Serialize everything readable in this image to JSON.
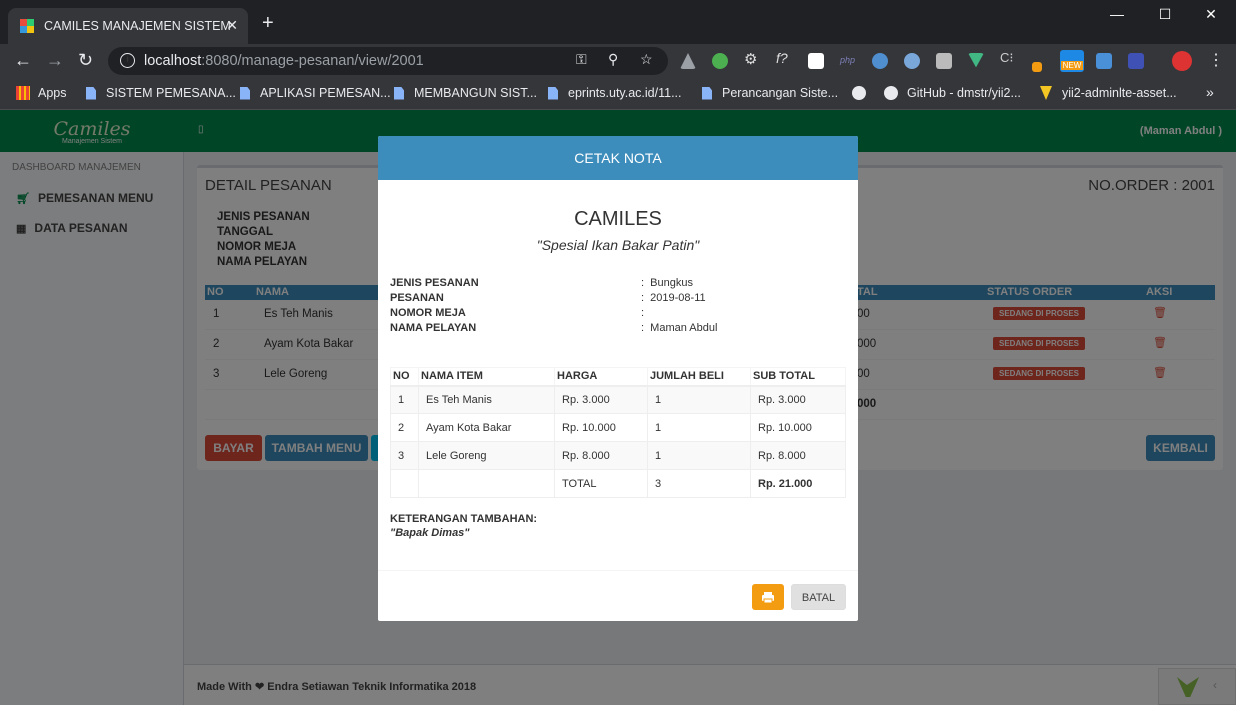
{
  "browser": {
    "tab_title": "CAMILES MANAJEMEN SISTEM",
    "url_host": "localhost",
    "url_path": ":8080/manage-pesanan/view/2001",
    "bookmarks": [
      "Apps",
      "SISTEM PEMESANA...",
      "APLIKASI PEMESAN...",
      "MEMBANGUN SIST...",
      "eprints.uty.ac.id/11...",
      "Perancangan Siste...",
      "GitHub - dmstr/yii2...",
      "yii2-adminlte-asset..."
    ],
    "new_badge": "NEW"
  },
  "app": {
    "logo": "Camiles",
    "logo_sub": "Manajemen Sistem",
    "user": "(Maman Abdul )",
    "toggle": "▯",
    "sidebar": {
      "header": "DASHBOARD MANAJEMEN",
      "items": [
        "PEMESANAN MENU",
        "DATA PESANAN"
      ]
    },
    "detail": {
      "title": "DETAIL PESANAN",
      "order_no": "NO.ORDER : 2001",
      "labels": [
        "JENIS PESANAN",
        "TANGGAL",
        "NOMOR MEJA",
        "NAMA PELAYAN"
      ],
      "columns": [
        "NO",
        "NAMA",
        "TAL",
        "STATUS ORDER",
        "AKSI"
      ],
      "rows": [
        {
          "no": "1",
          "nama": "Es Teh Manis",
          "total": "00",
          "status": "SEDANG DI PROSES"
        },
        {
          "no": "2",
          "nama": "Ayam Kota Bakar",
          "total": "000",
          "status": "SEDANG DI PROSES"
        },
        {
          "no": "3",
          "nama": "Lele Goreng",
          "total": "00",
          "status": "SEDANG DI PROSES"
        }
      ],
      "total": "000",
      "buttons": {
        "bayar": "BAYAR",
        "tambah": "TAMBAH MENU",
        "kembali": "KEMBALI"
      }
    },
    "footer": "Made With ❤ Endra Setiawan Teknik Informatika 2018"
  },
  "modal": {
    "header": "CETAK NOTA",
    "title": "CAMILES",
    "subtitle": "\"Spesial Ikan Bakar Patin\"",
    "info": [
      {
        "label": "JENIS PESANAN",
        "value": "Bungkus"
      },
      {
        "label": "PESANAN",
        "value": "2019-08-11"
      },
      {
        "label": "NOMOR MEJA",
        "value": ""
      },
      {
        "label": "NAMA PELAYAN",
        "value": "Maman Abdul"
      }
    ],
    "columns": [
      "NO",
      "NAMA ITEM",
      "HARGA",
      "JUMLAH BELI",
      "SUB TOTAL"
    ],
    "items": [
      {
        "no": "1",
        "nama": "Es Teh Manis",
        "harga": "Rp. 3.000",
        "jumlah": "1",
        "sub": "Rp. 3.000"
      },
      {
        "no": "2",
        "nama": "Ayam Kota Bakar",
        "harga": "Rp. 10.000",
        "jumlah": "1",
        "sub": "Rp. 10.000"
      },
      {
        "no": "3",
        "nama": "Lele Goreng",
        "harga": "Rp. 8.000",
        "jumlah": "1",
        "sub": "Rp. 8.000"
      }
    ],
    "total_label": "TOTAL",
    "total_qty": "3",
    "total_sum": "Rp. 21.000",
    "note_label": "KETERANGAN TAMBAHAN:",
    "note": "\"Bapak Dimas\"",
    "cancel": "BATAL"
  }
}
